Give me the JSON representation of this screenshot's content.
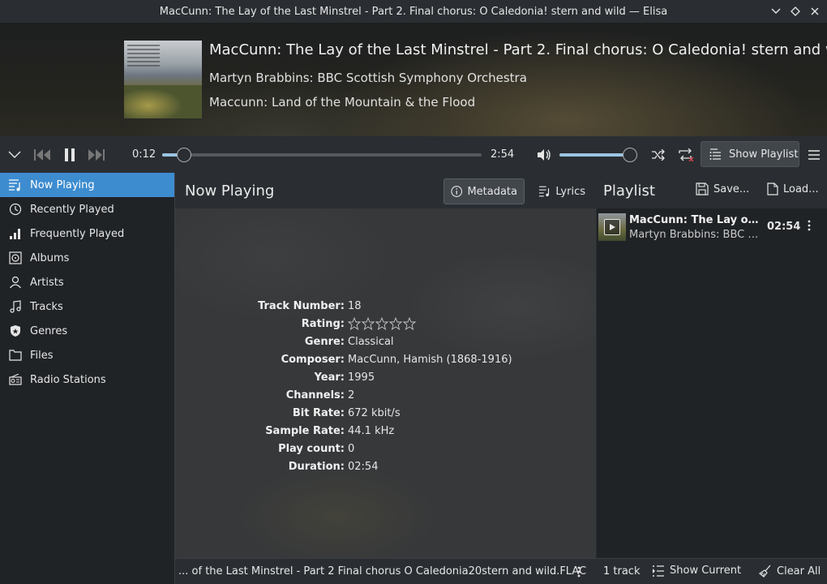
{
  "window": {
    "title": "MacCunn: The Lay of the Last Minstrel - Part 2. Final chorus: O Caledonia! stern and wild — Elisa"
  },
  "now_playing_header": {
    "track_title": "MacCunn: The Lay of the Last Minstrel - Part 2. Final chorus: O Caledonia! stern and wild",
    "artist": "Martyn Brabbins: BBC Scottish Symphony Orchestra",
    "album": "Maccunn: Land of the Mountain & the Flood"
  },
  "playback": {
    "elapsed": "0:12",
    "total": "2:54",
    "progress_fraction": 0.069,
    "volume_fraction": 0.97,
    "show_playlist_label": "Show Playlist"
  },
  "sidebar": {
    "items": [
      {
        "label": "Now Playing",
        "icon": "now-playing-icon",
        "active": true
      },
      {
        "label": "Recently Played",
        "icon": "recently-played-icon"
      },
      {
        "label": "Frequently Played",
        "icon": "frequently-played-icon"
      },
      {
        "label": "Albums",
        "icon": "albums-icon"
      },
      {
        "label": "Artists",
        "icon": "artists-icon"
      },
      {
        "label": "Tracks",
        "icon": "tracks-icon"
      },
      {
        "label": "Genres",
        "icon": "genres-icon"
      },
      {
        "label": "Files",
        "icon": "files-icon"
      },
      {
        "label": "Radio Stations",
        "icon": "radio-stations-icon"
      }
    ]
  },
  "main": {
    "title": "Now Playing",
    "tabs": {
      "metadata": "Metadata",
      "lyrics": "Lyrics"
    },
    "metadata": [
      {
        "label": "Track Number:",
        "value": "18"
      },
      {
        "label": "Rating:",
        "value": "",
        "stars": 0,
        "max_stars": 5
      },
      {
        "label": "Genre:",
        "value": "Classical"
      },
      {
        "label": "Composer:",
        "value": "MacCunn, Hamish (1868-1916)"
      },
      {
        "label": "Year:",
        "value": "1995"
      },
      {
        "label": "Channels:",
        "value": "2"
      },
      {
        "label": "Bit Rate:",
        "value": "672 kbit/s"
      },
      {
        "label": "Sample Rate:",
        "value": "44.1 kHz"
      },
      {
        "label": "Play count:",
        "value": "0"
      },
      {
        "label": "Duration:",
        "value": "02:54"
      }
    ],
    "file_path": "... of the Last Minstrel - Part 2 Final chorus O Caledonia20stern and wild.FLAC"
  },
  "playlist": {
    "title": "Playlist",
    "save_label": "Save...",
    "load_label": "Load...",
    "tracks": [
      {
        "title": "MacCunn: The Lay of the Last Minstrel - Part 2. Final chorus: O Caledonia! stern and wild",
        "artist": "Martyn Brabbins: BBC Scottish Symphony Orchestra",
        "duration": "02:54"
      }
    ],
    "track_count": "1 track",
    "show_current_label": "Show Current",
    "clear_all_label": "Clear All"
  },
  "colors": {
    "accent": "#3d8ccf",
    "slider_fill": "#9bc4e2",
    "background": "#2a2e32",
    "sidebar_bg": "#202326"
  }
}
